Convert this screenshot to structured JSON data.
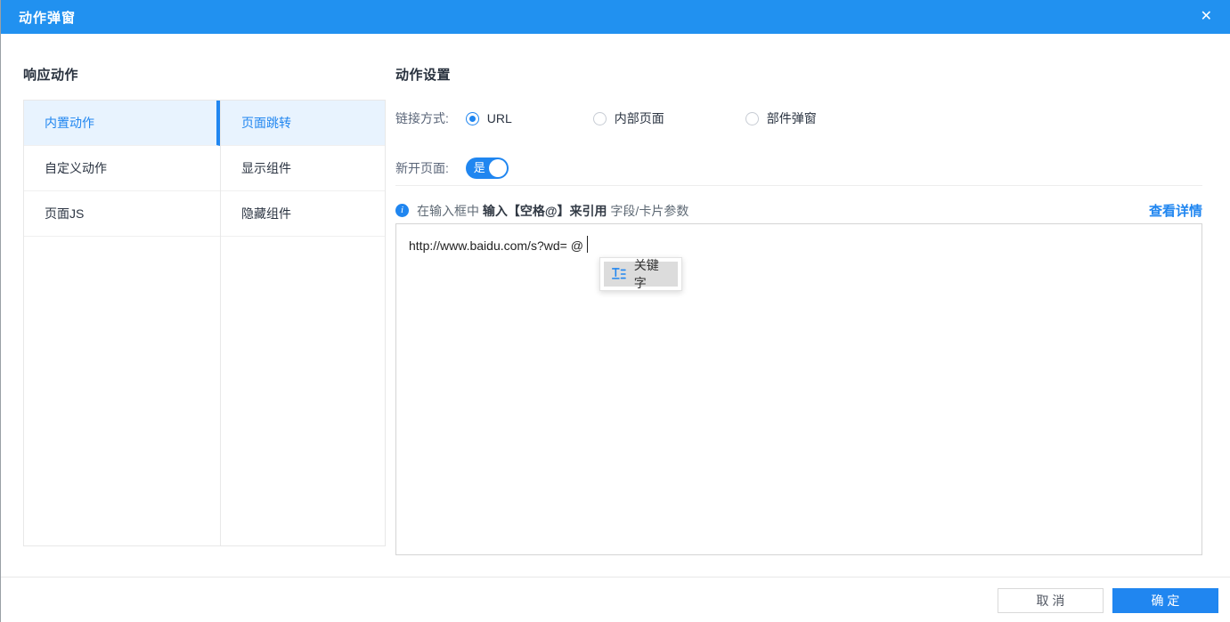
{
  "window": {
    "title": "动作弹窗",
    "close_icon": "✕"
  },
  "colors": {
    "primary": "#2086f0",
    "header": "#2191f0",
    "selected_bg": "#e8f3fe"
  },
  "response_action": {
    "heading": "响应动作",
    "categories": [
      {
        "label": "内置动作",
        "selected": true
      },
      {
        "label": "自定义动作",
        "selected": false
      },
      {
        "label": "页面JS",
        "selected": false
      }
    ],
    "subactions": [
      {
        "label": "页面跳转",
        "selected": true
      },
      {
        "label": "显示组件",
        "selected": false
      },
      {
        "label": "隐藏组件",
        "selected": false
      }
    ]
  },
  "action_settings": {
    "heading": "动作设置",
    "link_type": {
      "label": "链接方式: ",
      "options": [
        {
          "label": "URL",
          "selected": true
        },
        {
          "label": "内部页面",
          "selected": false
        },
        {
          "label": "部件弹窗",
          "selected": false
        }
      ]
    },
    "new_page": {
      "label": "新开页面: ",
      "state_label": "是",
      "on": true
    },
    "hint": {
      "info_icon": "i",
      "text_prefix": "在输入框中 ",
      "text_bold": "输入【空格@】来引用",
      "text_suffix": " 字段/卡片参数",
      "details_link": "查看详情"
    },
    "url_input": {
      "value": "http://www.baidu.com/s?wd= @"
    },
    "suggestion": {
      "icon": "field-text-icon",
      "label": "关键字"
    }
  },
  "footer": {
    "cancel_label": "取 消",
    "confirm_label": "确 定"
  }
}
